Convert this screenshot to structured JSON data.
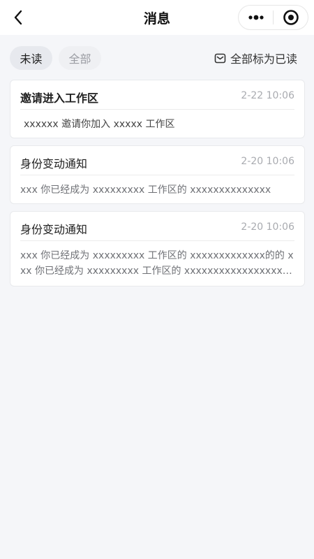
{
  "nav": {
    "title": "消息",
    "back_icon": "chevron-left-icon",
    "more_icon": "more-dots-icon",
    "capsule_close_icon": "target-circle-icon"
  },
  "filter": {
    "tabs": [
      {
        "label": "未读",
        "selected": true
      },
      {
        "label": "全部",
        "selected": false
      }
    ],
    "mark_all_read_label": "全部标为已读",
    "mark_all_read_icon": "envelope-icon"
  },
  "messages": [
    {
      "title": "邀请进入工作区",
      "time": "2-22 10:06",
      "body": "xxxxxx 邀请你加入 xxxxx 工作区",
      "unread": true
    },
    {
      "title": "身份变动通知",
      "time": "2-20 10:06",
      "body": "xxx 你已经成为 xxxxxxxxx 工作区的 xxxxxxxxxxxxxx",
      "unread": false
    },
    {
      "title": "身份变动通知",
      "time": "2-20 10:06",
      "body": "xxx 你已经成为 xxxxxxxxx 工作区的 xxxxxxxxxxxxx的的 xxx 你已经成为 xxxxxxxxx 工作区的 xxxxxxxxxxxxxxxxxxxxxx",
      "unread": false
    }
  ]
}
